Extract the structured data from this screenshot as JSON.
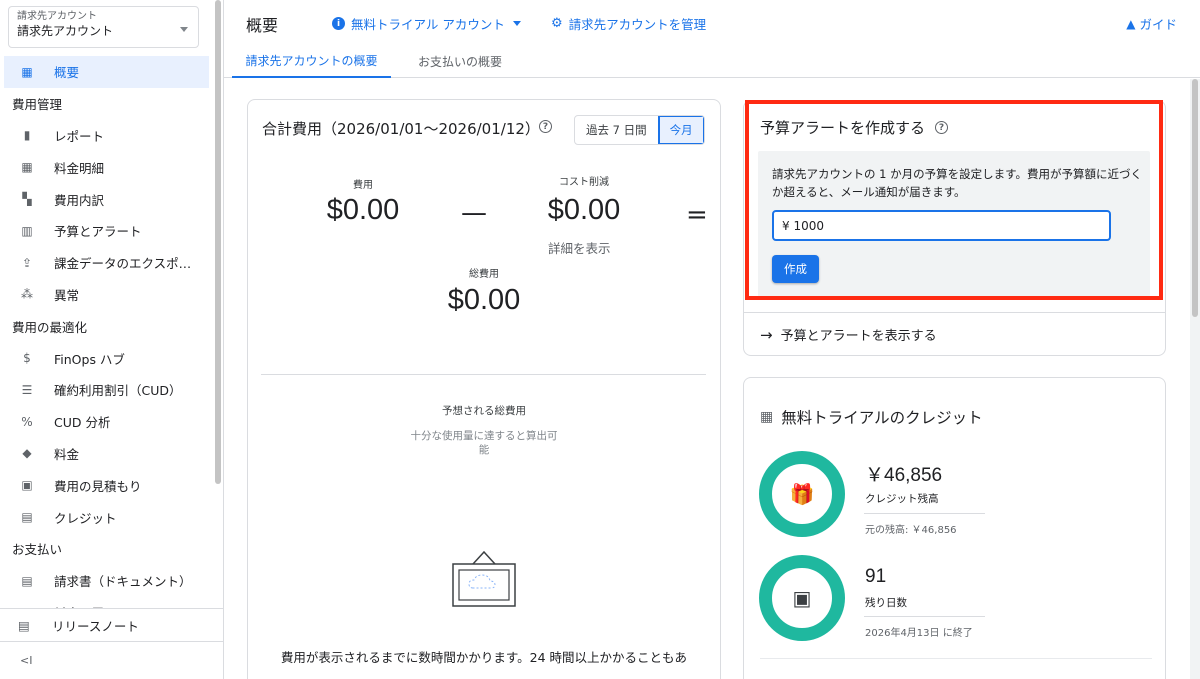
{
  "sidebar": {
    "account_label": "請求先アカウント",
    "account_value": "請求先アカウント",
    "items": [
      {
        "type": "item",
        "label": "概要",
        "icon": "dashboard-icon",
        "glyph": "▦",
        "active": true
      },
      {
        "type": "section",
        "label": "費用管理"
      },
      {
        "type": "item",
        "label": "レポート",
        "icon": "bar-chart-icon",
        "glyph": "▮"
      },
      {
        "type": "item",
        "label": "料金明細",
        "icon": "table-icon",
        "glyph": "▦"
      },
      {
        "type": "item",
        "label": "費用内訳",
        "icon": "breakdown-icon",
        "glyph": "▚"
      },
      {
        "type": "item",
        "label": "予算とアラート",
        "icon": "budget-icon",
        "glyph": "▥"
      },
      {
        "type": "item",
        "label": "課金データのエクスポ…",
        "icon": "upload-icon",
        "glyph": "⇪"
      },
      {
        "type": "item",
        "label": "異常",
        "icon": "anomaly-icon",
        "glyph": "⁂"
      },
      {
        "type": "section",
        "label": "費用の最適化"
      },
      {
        "type": "item",
        "label": "FinOps ハブ",
        "icon": "dollar-icon",
        "glyph": "$"
      },
      {
        "type": "item",
        "label": "確約利用割引（CUD）",
        "icon": "list-icon",
        "glyph": "☰"
      },
      {
        "type": "item",
        "label": "CUD 分析",
        "icon": "percent-icon",
        "glyph": "%"
      },
      {
        "type": "item",
        "label": "料金",
        "icon": "tag-icon",
        "glyph": "◆"
      },
      {
        "type": "item",
        "label": "費用の見積もり",
        "icon": "calculator-icon",
        "glyph": "▣"
      },
      {
        "type": "item",
        "label": "クレジット",
        "icon": "gift-icon",
        "glyph": "▤"
      },
      {
        "type": "section",
        "label": "お支払い"
      },
      {
        "type": "item",
        "label": "請求書（ドキュメント）",
        "icon": "document-icon",
        "glyph": "▤"
      },
      {
        "type": "item",
        "label": "料金の履歴",
        "icon": "history-icon",
        "glyph": "▤"
      }
    ],
    "release_notes": "リリースノート",
    "collapse": "<I"
  },
  "header": {
    "title": "概要",
    "trial_link": "無料トライアル アカウント",
    "manage_link": "請求先アカウントを管理",
    "guide_link": "ガイド"
  },
  "tabs": [
    {
      "label": "請求先アカウントの概要",
      "active": true
    },
    {
      "label": "お支払いの概要",
      "active": false
    }
  ],
  "cost_card": {
    "title": "合計費用（2026/01/01〜2026/01/12）",
    "range_past7": "過去 7 日間",
    "range_month": "今月",
    "cost_label": "費用",
    "cost_value": "$0.00",
    "minus": "—",
    "savings_label": "コスト削減",
    "savings_value": "$0.00",
    "equals": "=",
    "details_link": "詳細を表示",
    "total_label": "総費用",
    "total_value": "$0.00",
    "projected_label": "予想される総費用",
    "projected_note": "十分な使用量に達すると算出可能",
    "footer_note": "費用が表示されるまでに数時間かかります。24 時間以上かかることもあ"
  },
  "budget_card": {
    "title": "予算アラートを作成する",
    "description": "請求先アカウントの 1 か月の予算を設定します。費用が予算額に近づくか超えると、メール通知が届きます。",
    "input_value": "¥ 1000",
    "create_button": "作成",
    "view_link": "予算とアラートを表示する"
  },
  "credit_card": {
    "title": "無料トライアルのクレジット",
    "balance_value": "￥46,856",
    "balance_label": "クレジット残高",
    "original_balance": "元の残高: ￥46,856",
    "days_value": "91",
    "days_label": "残り日数",
    "end_date": "2026年4月13日 に終了"
  },
  "colors": {
    "accent": "#1a73e8",
    "ring": "#1fb89f",
    "highlight": "#ff2a12"
  }
}
